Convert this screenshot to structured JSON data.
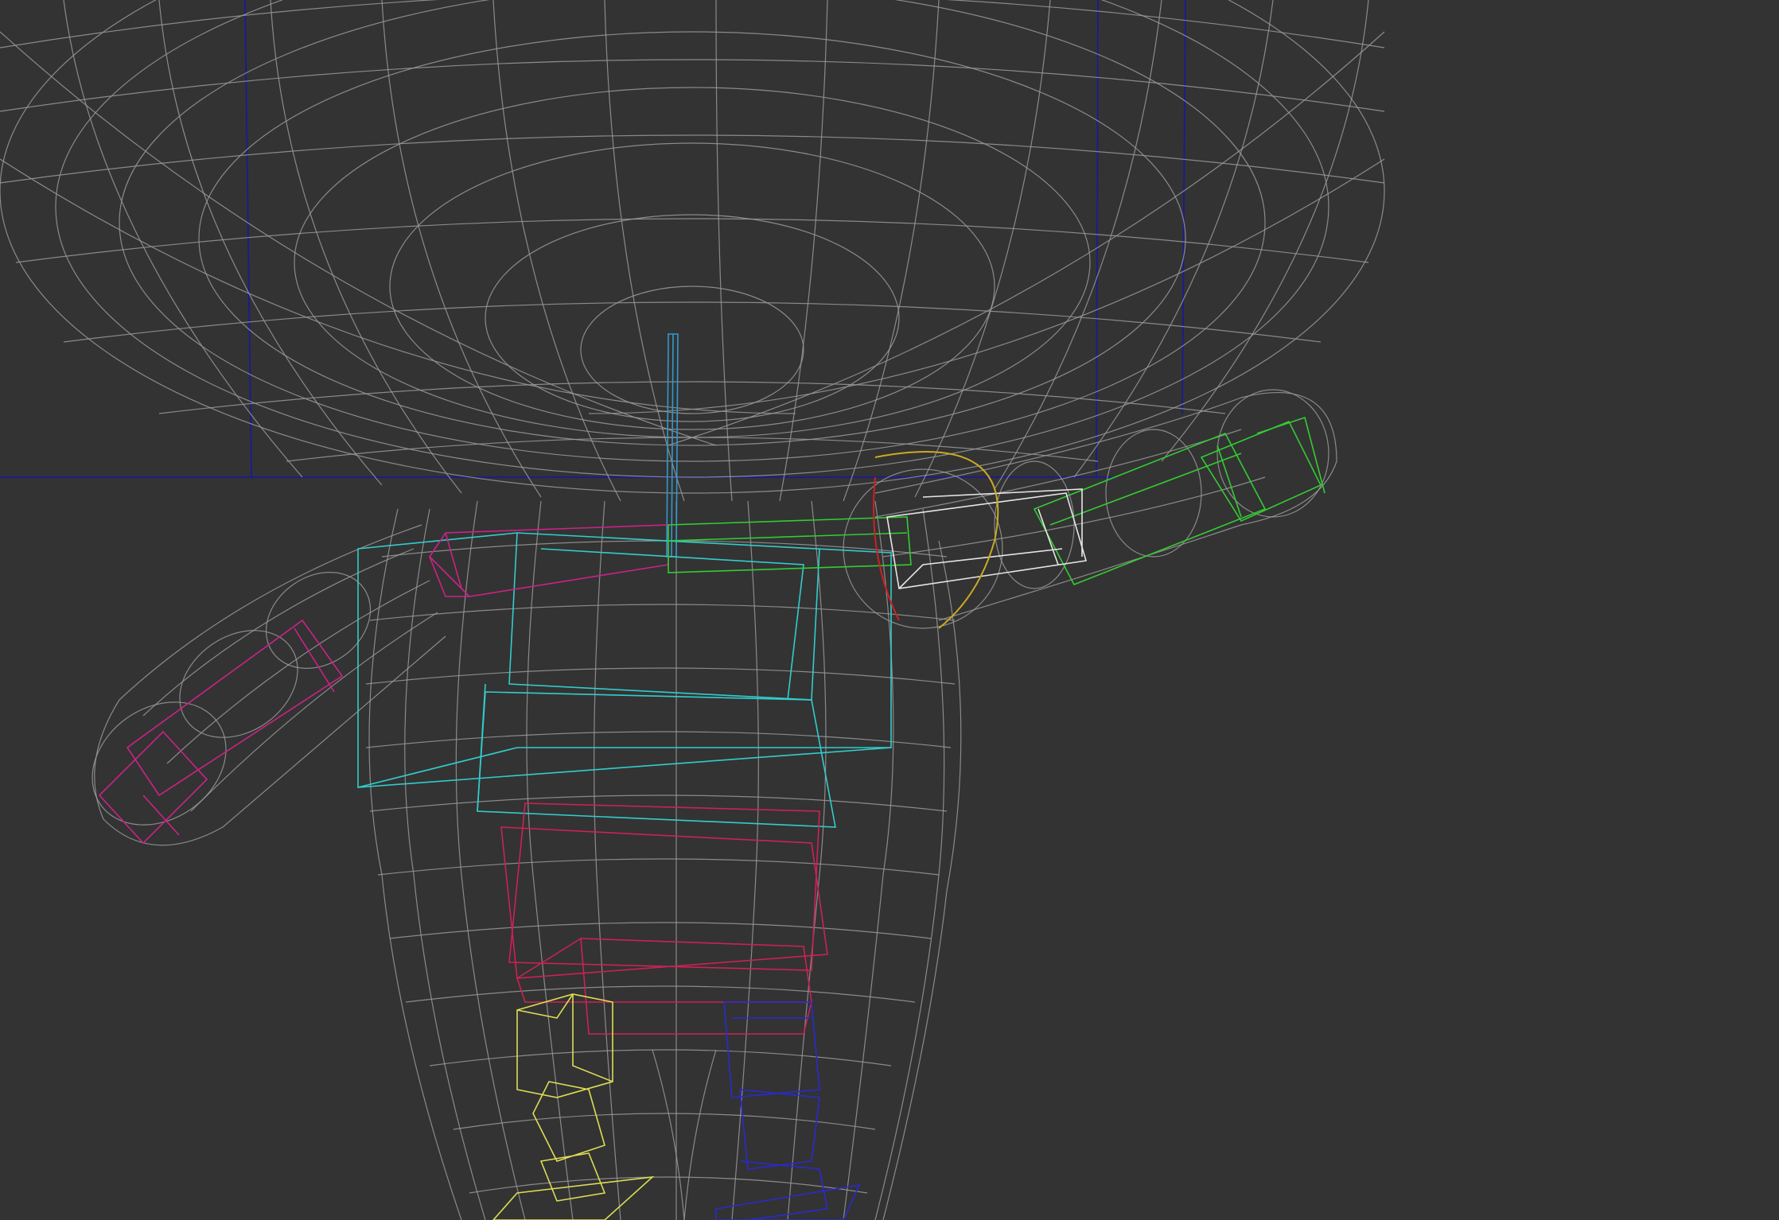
{
  "viewport": {
    "mode": "wireframe",
    "background": "#333333",
    "mesh_color": "#9a9a9a",
    "construction_line_color": "#1c1c8c"
  },
  "rig": {
    "spine_color": "#33cccc",
    "pelvis_color": "#cc2255",
    "left_arm_color": "#cc2288",
    "right_arm_color": "#33cc33",
    "selected_bone_color": "#e6e6e6",
    "left_leg_color": "#dddd55",
    "right_leg_color": "#2a2ad0",
    "neck_color": "#3399cc",
    "rotation_gizmo_color": "#ccaa22"
  }
}
